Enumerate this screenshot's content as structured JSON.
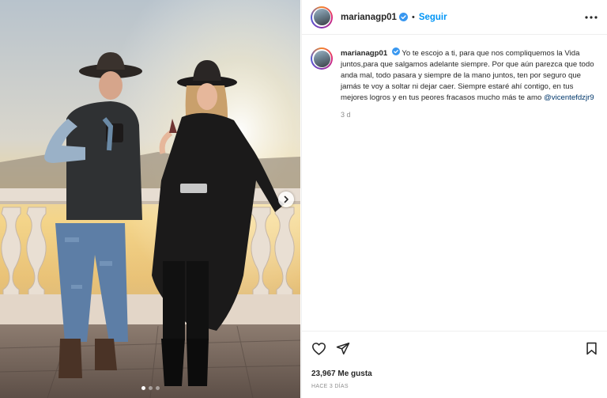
{
  "post": {
    "author": "marianagp01",
    "follow_label": "Seguir",
    "separator": "•",
    "caption": {
      "text": "Yo te escojo a ti, para que nos compliquemos la Vida juntos,para que salgamos adelante siempre. Por que aún parezca que todo anda mal, todo pasara y siempre de la mano juntos, ten por seguro que jamás te voy a soltar ni dejar caer. Siempre estaré ahí contigo, en tus mejores logros y en tus peores fracasos mucho más te amo",
      "mention": "@vicentefdzjr9",
      "time_ago": "3 d"
    },
    "likes": "23,967 Me gusta",
    "posted": "HACE 3 DÍAS",
    "carousel": {
      "current": 1,
      "total": 3
    }
  },
  "icons": {
    "more": "more-horizontal-icon",
    "verified": "verified-badge-icon",
    "next": "chevron-right-icon",
    "like": "heart-icon",
    "share": "paper-plane-icon",
    "save": "bookmark-icon"
  },
  "colors": {
    "follow": "#0095f6",
    "verified": "#3897f0",
    "mention": "#00376b",
    "muted": "#8e8e8e"
  }
}
